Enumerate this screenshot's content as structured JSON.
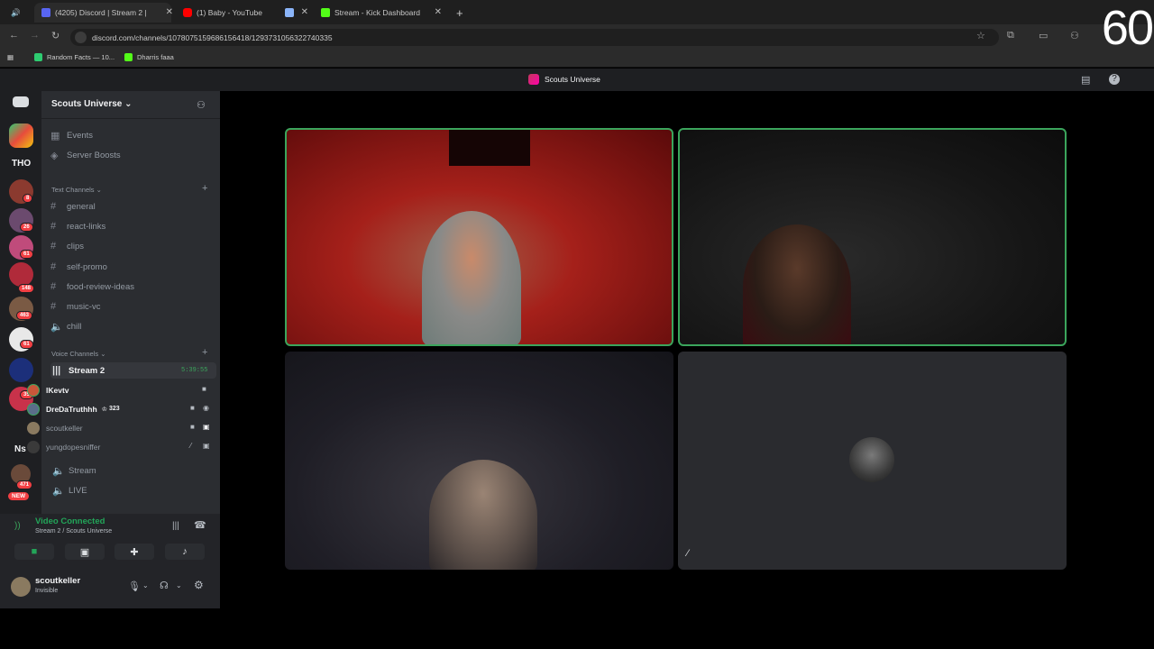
{
  "browser": {
    "tabs": [
      {
        "label": "(4205) Discord | Stream 2 |",
        "favicon_color": "#5865f2"
      },
      {
        "label": "(1) Baby - YouTube",
        "favicon_color": "#ff0000"
      },
      {
        "label": "",
        "favicon_color": "#8ab4f8"
      },
      {
        "label": "Stream - Kick Dashboard",
        "favicon_color": "#53fc18"
      }
    ],
    "url": "discord.com/channels/1078075159686156418/1293731056322740335",
    "bookmarks": [
      {
        "label": "Random Facts — 10...",
        "icon_color": "#2ecc71"
      },
      {
        "label": "Dharris faaa",
        "icon_color": "#53fc18"
      }
    ],
    "overlay_counter": "60"
  },
  "discord": {
    "window_title": "Scouts Universe",
    "guild_name": "Scouts Universe",
    "top_items": [
      {
        "label": "Events",
        "icon": "calendar-icon"
      },
      {
        "label": "Server Boosts",
        "icon": "boost-icon"
      }
    ],
    "text_category": "Text Channels",
    "text_channels": [
      "general",
      "react-links",
      "clips",
      "self-promo",
      "food-review-ideas",
      "music-vc",
      "chill"
    ],
    "voice_category": "Voice Channels",
    "voice_channel": {
      "name": "Stream 2",
      "timer": "5:39:55"
    },
    "voice_users": [
      {
        "name": "lKevtv",
        "tag": "",
        "color": "#f2f3f5",
        "bold": true
      },
      {
        "name": "DreDaTruthhh",
        "tag": "323",
        "color": "#f2f3f5",
        "bold": true
      },
      {
        "name": "scoutkeller",
        "tag": "",
        "color": "#949ba4",
        "bold": false
      },
      {
        "name": "yungdopesniffer",
        "tag": "",
        "color": "#949ba4",
        "bold": false
      }
    ],
    "other_channels": [
      "Stream",
      "LIVE"
    ],
    "connection": {
      "status": "Video Connected",
      "location": "Stream 2 / Scouts Universe"
    },
    "current_user": {
      "name": "scoutkeller",
      "status": "Invisible"
    },
    "server_badges": [
      "8",
      "26",
      "61",
      "148",
      "463",
      "61",
      "35",
      "471"
    ],
    "server_labels": [
      "THO",
      "Ns"
    ],
    "new_badge": "NEW"
  },
  "colors": {
    "accent_green": "#3ba55c",
    "brand": "#5865f2",
    "mention_red": "#f23f43"
  }
}
